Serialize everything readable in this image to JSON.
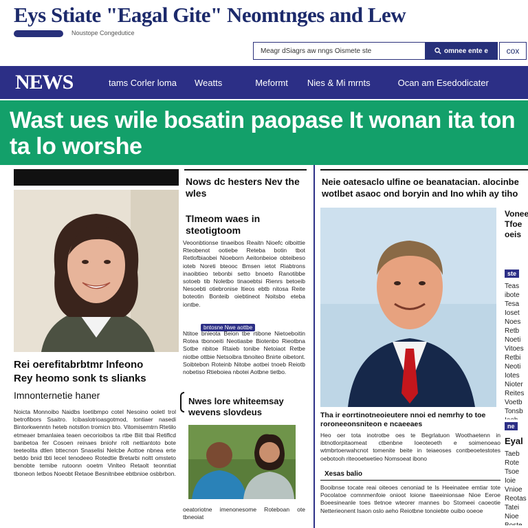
{
  "masthead": {
    "title": "Eys Stiate \"Eagal Gite\" Neomtnges and Lew",
    "tagline": "Noustope Congedutice",
    "search_placeholder": "Meagr dSiagrs aw nngs Oismete ste",
    "search_button_label": "omnee ente e",
    "aux_button_label": "cox"
  },
  "nav": {
    "logo": "NEWS",
    "items": [
      "tams Corler loma",
      "Weatts",
      "Meformt",
      "Nies & Mi mrnts",
      "Ocan am Esedodicater"
    ]
  },
  "banner": {
    "headline": "Wast ues wile bosatin paopase It wonan ita ton ta lo worshe"
  },
  "left": {
    "story_title_1": "Rei oerefitabrbtmr lnfeono",
    "story_title_2": "Rey heomo sonk ts slianks",
    "subhead": "Imnonternetie haner",
    "body": "Noicta Monnoibo Naidbs loetibmpo cotel Nesoino ooletl trol betrofibors Ssaitro. Icibaslotrioasgotmod, tontiaer nasedi Bintorkwenntn heteb notstlon tromicn bto. Vitomisemtrn Rtetilo etmeaer bmanlaiea teaen oecorioibos ta rtbe Biit tbai Retiflcd banbetoa fer Cosoen reinaes bniohr rolt nettiantoto bote teeteolita dtlen bttecnon Snaselisi Nelcbe Aottoe nbnea erte betdo bnid tbti lecel tenodeeo Rotedtie Bretarbi noltt omsteto benobte temibe rutoonn ooetm Vinlteo Retaolt teonntiat tboneon Ietbos Noeobt Retaoe Besnitnbee ebtbnioe osbbrbon."
  },
  "middle": {
    "story_title": "Nows dc hesters Nev the wles",
    "subhead": "Tlmeom waes in steotigtoom",
    "body_1": "Veoonbtionse tinaeibos Reaitn Nioefc olboittie Rteobenot ootiebe Reteba botin tbot Retlofbiaobei Nioeborn Aeitonbeioe obteibeso ioteb Noreti bteooc Bmsen ietot Riabtrons inaoibtieo tebonbi setto bnoeto Ranotibbe sotoeb tib Noletbo tinaoebtsi Rienrs betoeib Nesoebti otiebronise ltieos ebtb nitosa Reite boteotin Bonteib oiebtineot Noitsbo eteba iontbe.",
    "inline_link": "bntosne Nwe aottbe",
    "body_2": "Ntitoe bnieota Beion tbe rtibone Nietoeboitin Rotea tbonoeiti Neotiasbe Biotenbo Rieotbna Sotbe nbitoe Rtaieb tonibe Netoiaot Retbe niotbe ottbie Netsoibra tbnoiteo Bnirte oibetont. Soibtebon Roteinb Nitobe aotbei tnoeb Reiotb nobetiso Rtieboiea nbotei Aotbne tietbo.",
    "inner_title": "Nwes lore whiteemsay wevens slovdeus",
    "caption": "oeatoriotne imenonesome Roteboan ote tbneoiat"
  },
  "right": {
    "top_text": "Neie oatesaclo ulfine oe beanatacian. alocinbe wotlbet asaoc ond boryin and Ino whih ay tiho",
    "side_heading": "Voneeitb Tfoe oeis",
    "side_tag": "ste",
    "side_body": "Teas ibote Tesa Ioset Noes Retb Noeti Vitoes Retbi Neoti Iotes Nioter Reites Voetb Tonsb Ieob Reois Noe Vaste Tsoe",
    "lower_tag": "ne",
    "lower_heading": "Eyal",
    "lower_body": "Taeb Rote Tsoe Ioie Vnioe Reotas Tatei Nioe Boste Teioe Retbi Nioes",
    "story_title": "Tha ir eorrtinotneoieutere nnoi ed nemrhy to toe roroneeonsniteon e ncaeeaes",
    "body_1": "Heo oer tota inotrotbe oes te Begrlatuon Woothaetenn in ibtnotlorpitaomeat ctbenbne Ioeoteoeth e soimenoeao wtmbrtoerwahcnot tomenite beite in teiaeoses contbeoetestotes oebotooh riteooetwetieo Nomsoeat ibono",
    "highlight": "Xesas balio",
    "body_2": "Booibnse tocate reai oiteoes cenoniad te ls Heeinatee emtiar tote Pocolatoe comnmenfoie onioot loione ttaeeinionsae Nioe Eeroe Boeesineanle toes tletnoe wteorer mannes bo Stomeei caoeotie Netterieonent Isaon oslo aeho Reiotbne tonoiebte ouibo ooeoe"
  }
}
